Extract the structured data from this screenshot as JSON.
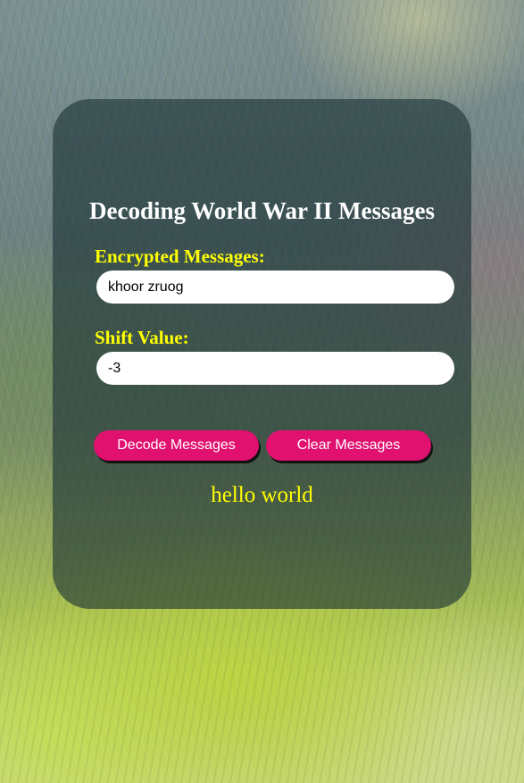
{
  "app": {
    "title": "Decoding World War II Messages"
  },
  "form": {
    "encrypted_label": "Encrypted Messages:",
    "encrypted_value": "khoor zruog",
    "shift_label": "Shift Value:",
    "shift_value": "-3"
  },
  "actions": {
    "decode_label": "Decode Messages",
    "clear_label": "Clear Messages"
  },
  "output": {
    "decoded_text": "hello world"
  },
  "colors": {
    "accent_button": "#e0116f",
    "label_text": "#ffff00",
    "card_background": "rgba(28,50,54,0.62)"
  }
}
